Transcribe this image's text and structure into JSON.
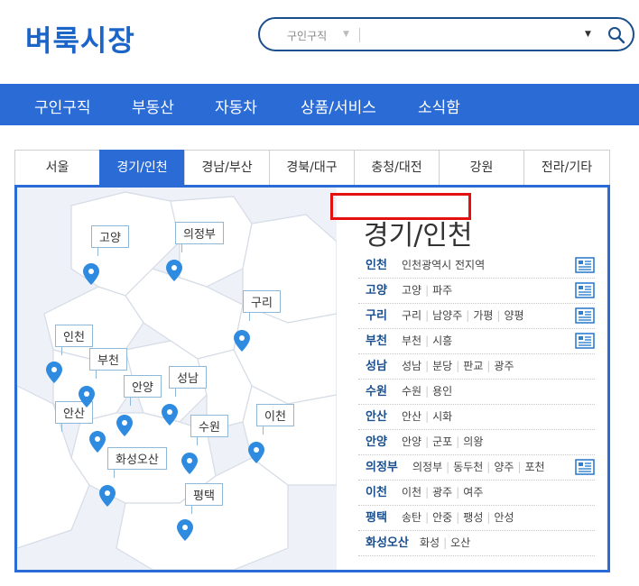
{
  "logo": "벼룩시장",
  "search": {
    "category": "구인구직",
    "placeholder": ""
  },
  "nav": [
    "구인구직",
    "부동산",
    "자동차",
    "상품/서비스",
    "소식함"
  ],
  "tabs": [
    "서울",
    "경기/인천",
    "경남/부산",
    "경북/대구",
    "충청/대전",
    "강원",
    "전라/기타"
  ],
  "active_tab": "경기/인천",
  "region_title": "경기/인천",
  "map_labels": [
    "고양",
    "의정부",
    "구리",
    "인천",
    "부천",
    "안양",
    "성남",
    "안산",
    "수원",
    "이천",
    "화성오산",
    "평택"
  ],
  "rows": [
    {
      "name": "인천",
      "cities": [
        "인천광역시 전지역"
      ],
      "icon": true
    },
    {
      "name": "고양",
      "cities": [
        "고양",
        "파주"
      ],
      "icon": true
    },
    {
      "name": "구리",
      "cities": [
        "구리",
        "남양주",
        "가평",
        "양평"
      ],
      "icon": true
    },
    {
      "name": "부천",
      "cities": [
        "부천",
        "시흥"
      ],
      "icon": true
    },
    {
      "name": "성남",
      "cities": [
        "성남",
        "분당",
        "판교",
        "광주"
      ],
      "icon": false
    },
    {
      "name": "수원",
      "cities": [
        "수원",
        "용인"
      ],
      "icon": false
    },
    {
      "name": "안산",
      "cities": [
        "안산",
        "시화"
      ],
      "icon": false
    },
    {
      "name": "안양",
      "cities": [
        "안양",
        "군포",
        "의왕"
      ],
      "icon": false
    },
    {
      "name": "의정부",
      "cities": [
        "의정부",
        "동두천",
        "양주",
        "포천"
      ],
      "icon": true
    },
    {
      "name": "이천",
      "cities": [
        "이천",
        "광주",
        "여주"
      ],
      "icon": false
    },
    {
      "name": "평택",
      "cities": [
        "송탄",
        "안중",
        "팽성",
        "안성"
      ],
      "icon": false
    },
    {
      "name": "화성오산",
      "cities": [
        "화성",
        "오산"
      ],
      "icon": false
    }
  ]
}
